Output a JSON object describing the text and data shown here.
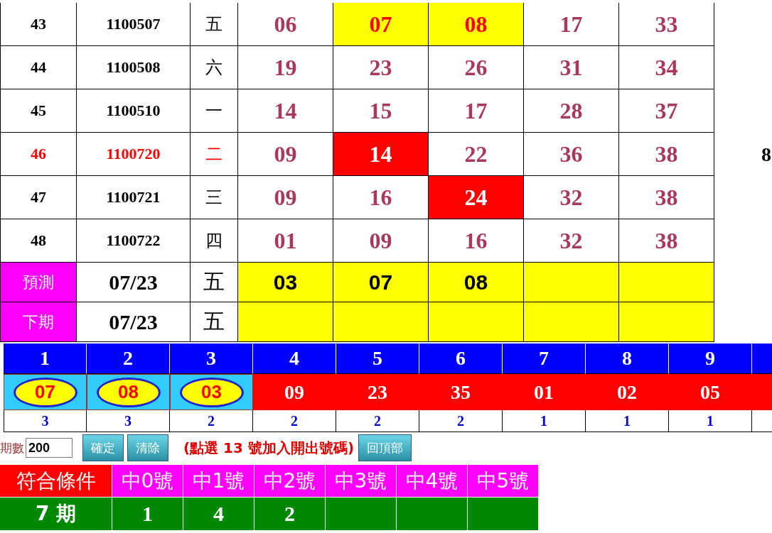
{
  "draws": [
    {
      "no": "43",
      "date": "1100507",
      "weekday": "五",
      "alert": false,
      "numbers": [
        {
          "value": "06"
        },
        {
          "value": "07",
          "color": "#ffff00"
        },
        {
          "value": "08",
          "color": "#ffff00"
        },
        {
          "value": "17"
        },
        {
          "value": "33"
        }
      ]
    },
    {
      "no": "44",
      "date": "1100508",
      "weekday": "六",
      "alert": false,
      "numbers": [
        {
          "value": "19"
        },
        {
          "value": "23"
        },
        {
          "value": "26"
        },
        {
          "value": "31"
        },
        {
          "value": "34"
        }
      ]
    },
    {
      "no": "45",
      "date": "1100510",
      "weekday": "一",
      "alert": false,
      "numbers": [
        {
          "value": "14"
        },
        {
          "value": "15"
        },
        {
          "value": "17"
        },
        {
          "value": "28"
        },
        {
          "value": "37"
        }
      ]
    },
    {
      "no": "46",
      "date": "1100720",
      "weekday": "二",
      "alert": true,
      "side": "8",
      "numbers": [
        {
          "value": "09"
        },
        {
          "value": "14",
          "color": "#ff0000"
        },
        {
          "value": "22"
        },
        {
          "value": "36"
        },
        {
          "value": "38"
        }
      ]
    },
    {
      "no": "47",
      "date": "1100721",
      "weekday": "三",
      "alert": false,
      "numbers": [
        {
          "value": "09"
        },
        {
          "value": "16"
        },
        {
          "value": "24",
          "color": "#ff0000"
        },
        {
          "value": "32"
        },
        {
          "value": "38"
        }
      ]
    },
    {
      "no": "48",
      "date": "1100722",
      "weekday": "四",
      "alert": false,
      "numbers": [
        {
          "value": "01"
        },
        {
          "value": "09"
        },
        {
          "value": "16"
        },
        {
          "value": "32"
        },
        {
          "value": "38"
        }
      ]
    }
  ],
  "forecast": [
    {
      "label": "預測",
      "date": "07/23",
      "weekday": "五",
      "numbers": [
        "03",
        "07",
        "08"
      ]
    },
    {
      "label": "下期",
      "date": "07/23",
      "weekday": "五"
    }
  ],
  "ranking": [
    {
      "rank": "1",
      "number": "07",
      "count": "3",
      "selected": true
    },
    {
      "rank": "2",
      "number": "08",
      "count": "3",
      "selected": true
    },
    {
      "rank": "3",
      "number": "03",
      "count": "2",
      "selected": true
    },
    {
      "rank": "4",
      "number": "09",
      "count": "2",
      "selected": false
    },
    {
      "rank": "5",
      "number": "23",
      "count": "2",
      "selected": false
    },
    {
      "rank": "6",
      "number": "35",
      "count": "2",
      "selected": false
    },
    {
      "rank": "7",
      "number": "01",
      "count": "1",
      "selected": false
    },
    {
      "rank": "8",
      "number": "02",
      "count": "1",
      "selected": false
    },
    {
      "rank": "9",
      "number": "05",
      "count": "1",
      "selected": false
    }
  ],
  "controls": {
    "periods_label": "期數",
    "periods_value": "200",
    "buttons": [
      "確定",
      "清除"
    ],
    "hint": "(點選 13 號加入開出號碼)",
    "top_button": "回頂部"
  },
  "match": {
    "header": "符合條件",
    "columns": [
      "中0號",
      "中1號",
      "中2號",
      "中3號",
      "中4號",
      "中5號"
    ],
    "row_label": "7 期",
    "values": [
      "1",
      "4",
      "2"
    ]
  }
}
